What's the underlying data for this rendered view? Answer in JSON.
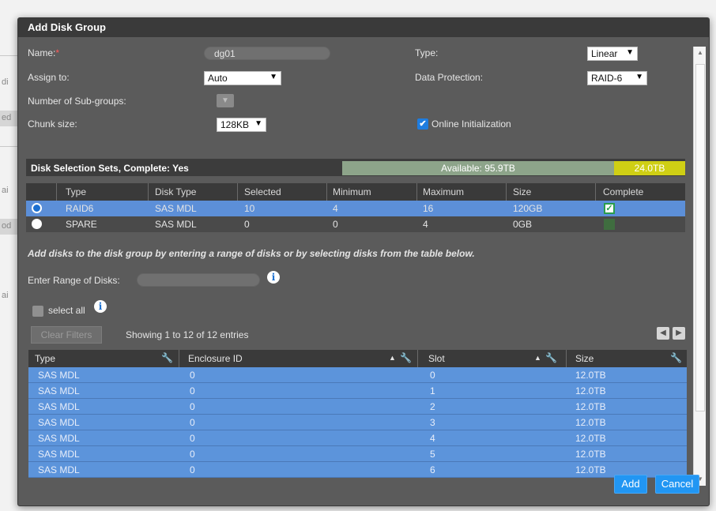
{
  "dialog": {
    "title": "Add Disk Group"
  },
  "form": {
    "name_label": "Name:",
    "name_required": "*",
    "name_value": "dg01",
    "type_label": "Type:",
    "type_value": "Linear",
    "assign_label": "Assign to:",
    "assign_value": "Auto",
    "protection_label": "Data Protection:",
    "protection_value": "RAID-6",
    "subgroups_label": "Number of Sub-groups:",
    "chunk_label": "Chunk size:",
    "chunk_value": "128KB",
    "online_init_label": "Online Initialization",
    "online_init_checked": true
  },
  "sets": {
    "title": "Disk Selection Sets, Complete: Yes",
    "available_label": "Available: 95.9TB",
    "used_label": "24.0TB",
    "columns": [
      "Type",
      "Disk Type",
      "Selected",
      "Minimum",
      "Maximum",
      "Size",
      "Complete"
    ],
    "rows": [
      {
        "type": "RAID6",
        "disk_type": "SAS MDL",
        "selected": "10",
        "minimum": "4",
        "maximum": "16",
        "size": "120GB",
        "complete": true,
        "active": true
      },
      {
        "type": "SPARE",
        "disk_type": "SAS MDL",
        "selected": "0",
        "minimum": "0",
        "maximum": "4",
        "size": "0GB",
        "complete": false,
        "active": false
      }
    ]
  },
  "instructions": "Add disks to the disk group by entering a range of disks or by selecting disks from the table below.",
  "range": {
    "label": "Enter Range of Disks:",
    "value": ""
  },
  "select_all": {
    "label": "select all"
  },
  "list": {
    "clear_filters": "Clear Filters",
    "showing": "Showing 1 to 12 of 12 entries"
  },
  "disks": {
    "columns": [
      "Type",
      "Enclosure ID",
      "Slot",
      "Size"
    ],
    "rows": [
      {
        "type": "SAS MDL",
        "enclosure": "0",
        "slot": "0",
        "size": "12.0TB"
      },
      {
        "type": "SAS MDL",
        "enclosure": "0",
        "slot": "1",
        "size": "12.0TB"
      },
      {
        "type": "SAS MDL",
        "enclosure": "0",
        "slot": "2",
        "size": "12.0TB"
      },
      {
        "type": "SAS MDL",
        "enclosure": "0",
        "slot": "3",
        "size": "12.0TB"
      },
      {
        "type": "SAS MDL",
        "enclosure": "0",
        "slot": "4",
        "size": "12.0TB"
      },
      {
        "type": "SAS MDL",
        "enclosure": "0",
        "slot": "5",
        "size": "12.0TB"
      },
      {
        "type": "SAS MDL",
        "enclosure": "0",
        "slot": "6",
        "size": "12.0TB"
      }
    ]
  },
  "buttons": {
    "add": "Add",
    "cancel": "Cancel"
  },
  "background": {
    "snippets": [
      "di",
      "ed",
      "ai",
      "od",
      "ai"
    ]
  },
  "colors": {
    "accent": "#2196f3",
    "row_selected": "#5c94db",
    "used_bar": "#cfcf14",
    "available_bar": "#8da48a"
  }
}
